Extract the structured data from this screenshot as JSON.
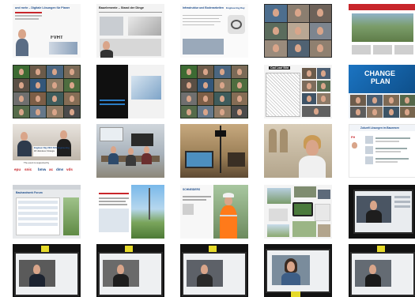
{
  "gallery": {
    "tiles": [
      {
        "row": 0,
        "col": 0,
        "type": "slide-title",
        "texts": [
          "und mehr – Digitale Lösungen für Planer",
          "",
          ""
        ],
        "logo": "FVHT"
      },
      {
        "row": 0,
        "col": 1,
        "type": "slide-product",
        "texts": [
          "Bauelemente – Stand der Dinge"
        ]
      },
      {
        "row": 0,
        "col": 2,
        "type": "slide-text",
        "texts": [
          "Infrastruktur und Bodenarbeiten",
          "Engineering Day"
        ]
      },
      {
        "row": 0,
        "col": 3,
        "type": "video-grid",
        "texts": []
      },
      {
        "row": 0,
        "col": 4,
        "type": "website-aerial",
        "texts": []
      },
      {
        "row": 1,
        "col": 0,
        "type": "video-grid-many",
        "texts": []
      },
      {
        "row": 1,
        "col": 1,
        "type": "slide-diagram",
        "texts": []
      },
      {
        "row": 1,
        "col": 2,
        "type": "video-grid-many",
        "texts": []
      },
      {
        "row": 1,
        "col": 3,
        "type": "collage-drawing",
        "texts": [
          "Cad Lauf Bild"
        ]
      },
      {
        "row": 1,
        "col": 4,
        "type": "video-blue-banner",
        "texts": [
          "CHANGE",
          "PLAN"
        ]
      },
      {
        "row": 2,
        "col": 0,
        "type": "studio-interview",
        "texts": [
          "Engineer Day 2021 FHS Engineering",
          "Wir diskutieren Strategie",
          "The event is supported by",
          "epu",
          "snic",
          "bmw",
          "ac",
          "dms",
          "vds"
        ]
      },
      {
        "row": 2,
        "col": 1,
        "type": "photo-room",
        "texts": []
      },
      {
        "row": 2,
        "col": 2,
        "type": "photo-studio",
        "texts": []
      },
      {
        "row": 2,
        "col": 3,
        "type": "photo-selfie",
        "texts": []
      },
      {
        "row": 2,
        "col": 4,
        "type": "slide-list",
        "texts": [
          "Zukunft Lösungen im Bauwesen",
          "FH"
        ]
      },
      {
        "row": 3,
        "col": 0,
        "type": "browser-form",
        "texts": [
          "Bauhandwerk Forum"
        ]
      },
      {
        "row": 3,
        "col": 1,
        "type": "browser-landscape",
        "texts": []
      },
      {
        "row": 3,
        "col": 2,
        "type": "browser-workers",
        "texts": [
          "SCHNEIDERS"
        ]
      },
      {
        "row": 3,
        "col": 3,
        "type": "collage-devices",
        "texts": []
      },
      {
        "row": 3,
        "col": 4,
        "type": "monitor-person",
        "texts": []
      },
      {
        "row": 4,
        "col": 0,
        "type": "monitor-person",
        "texts": []
      },
      {
        "row": 4,
        "col": 1,
        "type": "monitor-person",
        "texts": []
      },
      {
        "row": 4,
        "col": 2,
        "type": "monitor-person",
        "texts": []
      },
      {
        "row": 4,
        "col": 3,
        "type": "monitor-woman",
        "texts": []
      },
      {
        "row": 4,
        "col": 4,
        "type": "monitor-person",
        "texts": []
      }
    ]
  },
  "colors": {
    "accent_red": "#c8262b",
    "accent_blue": "#1f6fb8",
    "monitor_frame": "#1b1b1b",
    "sticky_yellow": "#e6da2a"
  },
  "icons": [
    "person",
    "presentation-slide",
    "monitor",
    "camera"
  ]
}
